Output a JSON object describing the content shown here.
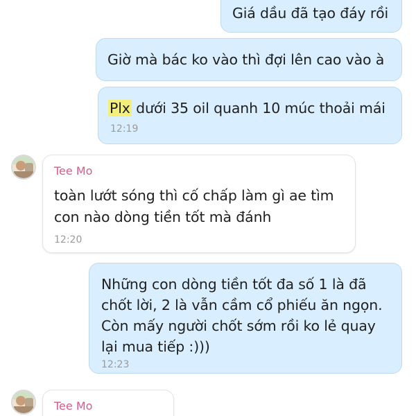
{
  "colors": {
    "my_bubble": "#d9efff",
    "their_bubble": "#ffffff",
    "sender_name": "#d55b8e",
    "highlight": "#f4ef7a",
    "timestamp": "#9a9a9a"
  },
  "messages": [
    {
      "from": "me",
      "lines": [
        "Giá dầu đã tạo đáy rồi"
      ],
      "time": ""
    },
    {
      "from": "me",
      "lines": [
        "Giờ mà bác ko vào thì đợi lên cao vào à"
      ],
      "time": ""
    },
    {
      "from": "me",
      "highlight": "Plx",
      "lines": [
        " dưới 35 oil quanh 10 múc thoải mái"
      ],
      "time": "12:19"
    },
    {
      "from": "other",
      "sender": "Tee Mo",
      "avatar_icon": "user-avatar-icon",
      "lines": [
        "toàn lướt sóng thì cố chấp làm gì ae tìm",
        "con nào dòng tiền tốt mà đánh"
      ],
      "time": "12:20"
    },
    {
      "from": "me",
      "lines": [
        "Những con dòng tiền tốt đa số 1 là đã",
        "chốt lời, 2 là vẫn cầm cổ phiếu ăn ngọn.",
        "Còn mấy người chốt sớm rồi ko lẻ quay",
        "lại mua tiếp :)))"
      ],
      "time": "12:23"
    },
    {
      "from": "other",
      "sender": "Tee Mo",
      "avatar_icon": "user-avatar-icon",
      "lines": [],
      "time": ""
    }
  ]
}
